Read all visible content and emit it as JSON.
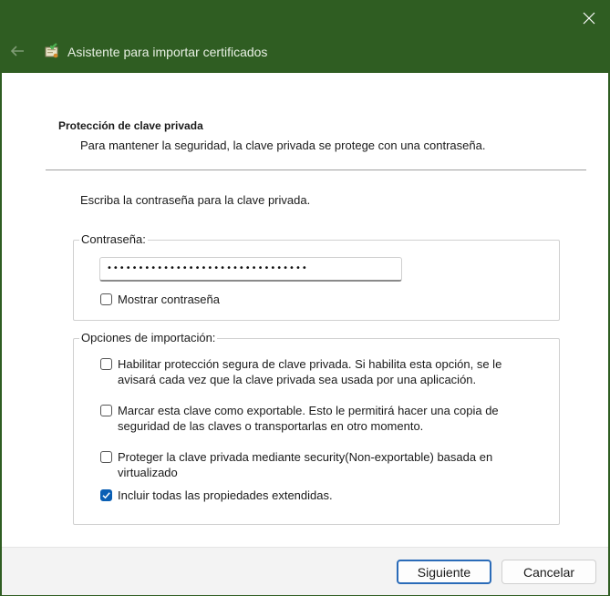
{
  "window": {
    "title": "Asistente para importar certificados",
    "icons": {
      "close": "close-icon",
      "back": "back-arrow-icon",
      "app": "certificate-import-icon"
    }
  },
  "header": {
    "title": "Protección de clave privada",
    "description": "Para mantener la seguridad, la clave privada se protege con una contraseña."
  },
  "intro": "Escriba la contraseña para la clave privada.",
  "password_group": {
    "legend": "Contraseña:",
    "masked_value": "••••••••••••••••••••••••••••••••",
    "show_password": {
      "label": "Mostrar contraseña",
      "checked": false
    }
  },
  "import_options": {
    "legend": "Opciones de importación:",
    "options": [
      {
        "line1": "Habilitar protección segura de clave privada. Si habilita esta opción, se le",
        "line2": "avisará cada vez que la clave privada sea usada por una aplicación.",
        "checked": false
      },
      {
        "line1": "Marcar esta clave como exportable. Esto le permitirá hacer una copia de",
        "line2": "seguridad de las claves o transportarlas en otro momento.",
        "checked": false
      },
      {
        "line1": "Proteger la clave privada mediante security(Non-exportable) basada en",
        "line2": "virtualizado",
        "checked": false
      },
      {
        "line1": "Incluir todas las propiedades extendidas.",
        "line2": "",
        "checked": true
      }
    ]
  },
  "buttons": {
    "next": "Siguiente",
    "cancel": "Cancelar"
  },
  "colors": {
    "titlebar": "#2f5d22",
    "accent": "#0a5fb4"
  }
}
